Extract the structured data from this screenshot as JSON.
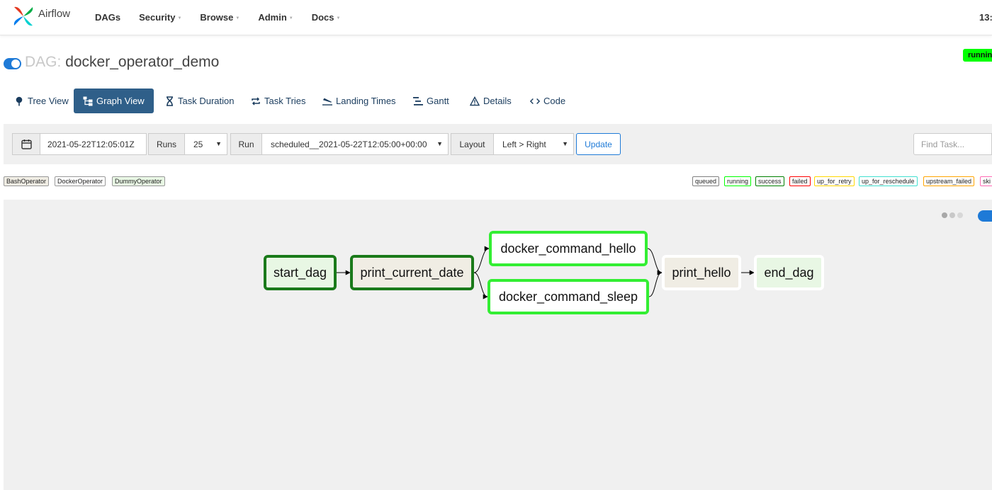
{
  "app": {
    "brand_name": "Airflow",
    "clock": "13:",
    "nav": [
      {
        "label": "DAGs",
        "dropdown": false
      },
      {
        "label": "Security",
        "dropdown": true
      },
      {
        "label": "Browse",
        "dropdown": true
      },
      {
        "label": "Admin",
        "dropdown": true
      },
      {
        "label": "Docs",
        "dropdown": true
      }
    ]
  },
  "dag": {
    "prefix": "DAG:",
    "name": "docker_operator_demo",
    "state": "running",
    "paused": false
  },
  "tabs": [
    {
      "label": "Tree View",
      "icon": "tree-icon",
      "active": false
    },
    {
      "label": "Graph View",
      "icon": "graph-icon",
      "active": true
    },
    {
      "label": "Task Duration",
      "icon": "hourglass-icon",
      "active": false
    },
    {
      "label": "Task Tries",
      "icon": "retry-icon",
      "active": false
    },
    {
      "label": "Landing Times",
      "icon": "plane-landing-icon",
      "active": false
    },
    {
      "label": "Gantt",
      "icon": "gantt-icon",
      "active": false
    },
    {
      "label": "Details",
      "icon": "warning-triangle-icon",
      "active": false
    },
    {
      "label": "Code",
      "icon": "code-icon",
      "active": false
    }
  ],
  "toolbar": {
    "base_date": "2021-05-22T12:05:01Z",
    "runs_label": "Runs",
    "runs_value": "25",
    "run_label": "Run",
    "run_value": "scheduled__2021-05-22T12:05:00+00:00",
    "layout_label": "Layout",
    "layout_value": "Left > Right",
    "update_label": "Update",
    "find_placeholder": "Find Task..."
  },
  "operators": [
    {
      "label": "BashOperator",
      "color": "#f0ede4"
    },
    {
      "label": "DockerOperator",
      "color": "#ffffff"
    },
    {
      "label": "DummyOperator",
      "color": "#e8f7e4"
    }
  ],
  "states": [
    {
      "label": "queued",
      "color": "#808080"
    },
    {
      "label": "running",
      "color": "#00ff00"
    },
    {
      "label": "success",
      "color": "#008000"
    },
    {
      "label": "failed",
      "color": "#ff0000"
    },
    {
      "label": "up_for_retry",
      "color": "#ffd700"
    },
    {
      "label": "up_for_reschedule",
      "color": "#40e0d0"
    },
    {
      "label": "upstream_failed",
      "color": "#ffa500"
    },
    {
      "label": "ski",
      "color": "#ff69b4"
    }
  ],
  "graph": {
    "nodes": [
      {
        "id": "start_dag",
        "label": "start_dag",
        "operator": "DummyOperator",
        "state": "success"
      },
      {
        "id": "print_current_date",
        "label": "print_current_date",
        "operator": "BashOperator",
        "state": "success"
      },
      {
        "id": "docker_command_hello",
        "label": "docker_command_hello",
        "operator": "DockerOperator",
        "state": "running"
      },
      {
        "id": "docker_command_sleep",
        "label": "docker_command_sleep",
        "operator": "DockerOperator",
        "state": "running"
      },
      {
        "id": "print_hello",
        "label": "print_hello",
        "operator": "BashOperator",
        "state": "none"
      },
      {
        "id": "end_dag",
        "label": "end_dag",
        "operator": "DummyOperator",
        "state": "none"
      }
    ],
    "edges": [
      [
        "start_dag",
        "print_current_date"
      ],
      [
        "print_current_date",
        "docker_command_hello"
      ],
      [
        "print_current_date",
        "docker_command_sleep"
      ],
      [
        "docker_command_hello",
        "print_hello"
      ],
      [
        "docker_command_sleep",
        "print_hello"
      ],
      [
        "print_hello",
        "end_dag"
      ]
    ]
  }
}
